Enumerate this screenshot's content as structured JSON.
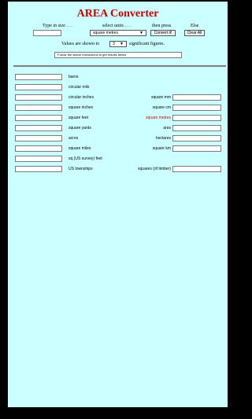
{
  "title": "AREA Converter",
  "header": {
    "col1": "Type in size . . .",
    "col2": "select units . . .",
    "col3": "then press",
    "col4": "Else",
    "units_selected": "square metres",
    "convert_label": "Convert it!",
    "clear_label": "Clear All",
    "sigfig_prefix": "Values are shown to",
    "sigfig_value": "3",
    "sigfig_suffix": "significant figures.",
    "instructions": "Follow the above instructions to get results below."
  },
  "left_units": [
    "barns",
    "circular mils",
    "circular inches",
    "square inches",
    "square feet",
    "square yards",
    "acres",
    "square miles",
    "sq.(US survey) feet",
    "US townships"
  ],
  "right_units": [
    "square mm",
    "square cm",
    "square metres",
    "ares",
    "hectares",
    "square km",
    "squares (of timber)"
  ],
  "colors": {
    "title": "#cc0000",
    "highlight": "#cc0000",
    "panel": "#ccffff"
  }
}
